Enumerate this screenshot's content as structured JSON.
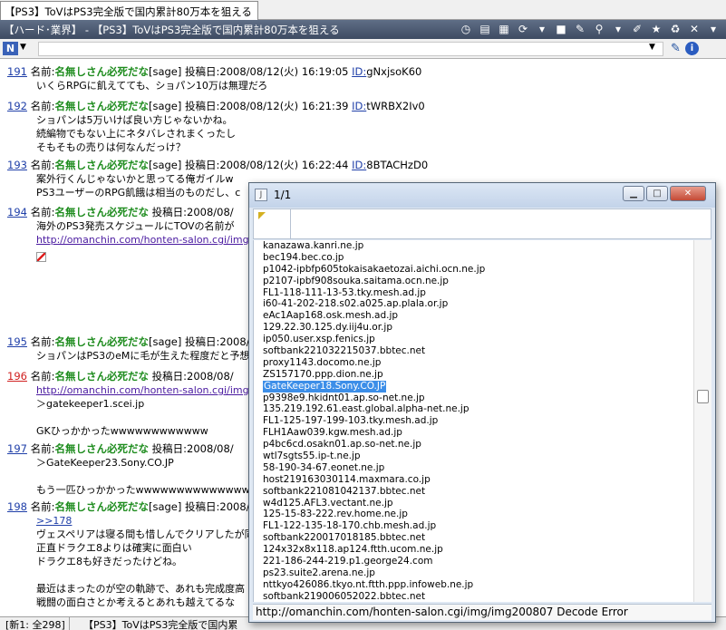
{
  "tab": {
    "label": "【PS3】ToVはPS3完全版で国内累計80万本を狙える"
  },
  "thread": {
    "title": "【ハード･業界】 - 【PS3】ToVはPS3完全版で国内累計80万本を狙える"
  },
  "addressbar": {
    "n_label": "N",
    "value": ""
  },
  "posts": [
    {
      "num": "191",
      "name_label": "名前:",
      "name": "名無しさん必死だな",
      "mail": "[sage]",
      "date": "投稿日:2008/08/12(火) 16:19:05",
      "id_label": "ID:",
      "id": "gNxjsoK60",
      "lines": [
        "いくらRPGに飢えてても、ショパン10万は無理だろ"
      ]
    },
    {
      "num": "192",
      "name_label": "名前:",
      "name": "名無しさん必死だな",
      "mail": "[sage]",
      "date": "投稿日:2008/08/12(火) 16:21:39",
      "id_label": "ID:",
      "id": "tWRBX2Iv0",
      "lines": [
        "ショパンは5万いけば良い方じゃないかね。",
        "続編物でもない上にネタバレされまくったし",
        "そもそもの売りは何なんだっけ？"
      ]
    },
    {
      "num": "193",
      "name_label": "名前:",
      "name": "名無しさん必死だな",
      "mail": "[sage]",
      "date": "投稿日:2008/08/12(火) 16:22:44",
      "id_label": "ID:",
      "id": "8BTACHzD0",
      "lines": [
        "案外行くんじゃないかと思ってる俺ガイルw",
        "PS3ユーザーのRPG飢餓は相当のものだし、c"
      ]
    },
    {
      "num": "194",
      "name_label": "名前:",
      "name": "名無しさん必死だな",
      "mail": "",
      "date": "投稿日:2008/08/",
      "id_label": "",
      "id": "",
      "lines": [
        "海外のPS3発売スケジュールにTOVの名前が"
      ],
      "link": "http://omanchin.com/honten-salon.cgi/img/im"
    },
    {
      "num": "195",
      "name_label": "名前:",
      "name": "名無しさん必死だな",
      "mail": "[sage]",
      "date": "投稿日:2008/08",
      "id_label": "",
      "id": "",
      "lines": [
        "ショパンはPS3のeMに毛が生えた程度だと予想"
      ]
    },
    {
      "num": "196",
      "name_label": "名前:",
      "name": "名無しさん必死だな",
      "mail": "",
      "date": "投稿日:2008/08/",
      "id_label": "",
      "id": "",
      "link": "http://omanchin.com/honten-salon.cgi/img/",
      "lines": [
        "＞gatekeeper1.scei.jp",
        "",
        "GKひっかかったwwwwwwwwwwww"
      ]
    },
    {
      "num": "197",
      "name_label": "名前:",
      "name": "名無しさん必死だな",
      "mail": "",
      "date": "投稿日:2008/08/",
      "id_label": "",
      "id": "",
      "lines": [
        "＞GateKeeper23.Sony.CO.JP",
        "",
        "もう一匹ひっかかったwwwwwwwwwwwwwwww"
      ]
    },
    {
      "num": "198",
      "name_label": "名前:",
      "name": "名無しさん必死だな",
      "mail": "[sage]",
      "date": "投稿日:2008/08/",
      "id_label": "",
      "id": "",
      "anchor": ">>178",
      "lines": [
        "ヴェスペリアは寝る間も惜しんでクリアしたが同意",
        "正直ドラクエ8よりは確実に面白い",
        "ドラクエ8も好きだったけどね。",
        "",
        "最近はまったのが空の軌跡で、あれも完成度高",
        "戦闘の面白さとか考えるとあれも越えてるな"
      ]
    }
  ],
  "statusbar": {
    "count": "[新1: 全298]",
    "title": "【PS3】ToVはPS3完全版で国内累"
  },
  "popup": {
    "title": "1/1",
    "min_glyph": "▁",
    "max_glyph": "□",
    "close_glyph": "✕",
    "selected_index": 14,
    "ips": [
      "kanazawa.kanri.ne.jp",
      "bec194.bec.co.jp",
      "p1042-ipbfp605tokaisakaetozai.aichi.ocn.ne.jp",
      "p2107-ipbf908souka.saitama.ocn.ne.jp",
      "FL1-118-111-13-53.tky.mesh.ad.jp",
      "i60-41-202-218.s02.a025.ap.plala.or.jp",
      "eAc1Aap168.osk.mesh.ad.jp",
      "129.22.30.125.dy.iij4u.or.jp",
      "ip050.user.xsp.fenics.jp",
      "softbank221032215037.bbtec.net",
      "proxy1143.docomo.ne.jp",
      "ZS157170.ppp.dion.ne.jp",
      "GateKeeper18.Sony.CO.JP",
      "p9398e9.hkidnt01.ap.so-net.ne.jp",
      "135.219.192.61.east.global.alpha-net.ne.jp",
      "FL1-125-197-199-103.tky.mesh.ad.jp",
      "FLH1Aaw039.kgw.mesh.ad.jp",
      "p4bc6cd.osakn01.ap.so-net.ne.jp",
      "wtl7sgts55.ip-t.ne.jp",
      "58-190-34-67.eonet.ne.jp",
      "host219163030114.maxmara.co.jp",
      "softbank221081042137.bbtec.net",
      "w4d125.AFL3.vectant.ne.jp",
      "125-15-83-222.rev.home.ne.jp",
      "FL1-122-135-18-170.chb.mesh.ad.jp",
      "softbank220017018185.bbtec.net",
      "124x32x8x118.ap124.ftth.ucom.ne.jp",
      "221-186-244-219.p1.george24.com",
      "ps23.suite2.arena.ne.jp",
      "nttkyo426086.tkyo.nt.ftth.ppp.infoweb.ne.jp",
      "softbank219006052022.bbtec.net"
    ],
    "status": "http://omanchin.com/honten-salon.cgi/img/img200807 Decode Error"
  }
}
